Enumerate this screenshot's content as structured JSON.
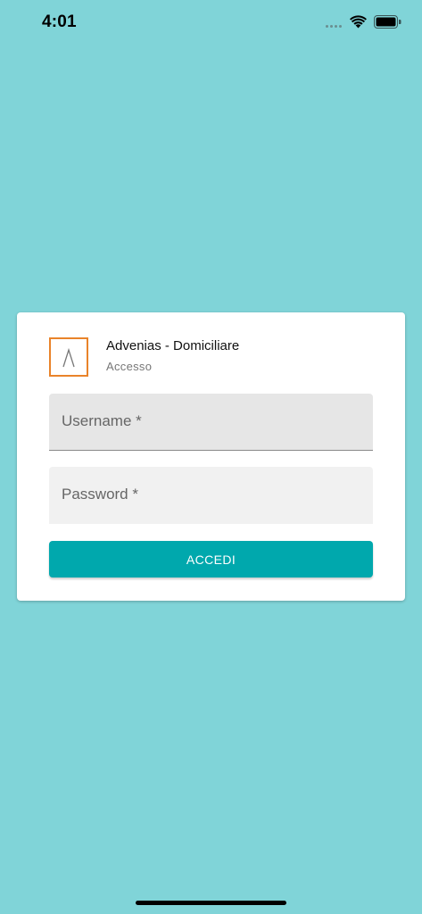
{
  "status_bar": {
    "time": "4:01"
  },
  "app": {
    "title": "Advenias - Domiciliare",
    "subtitle": "Accesso",
    "logo_color": "#e9832a"
  },
  "form": {
    "username_label": "Username *",
    "password_label": "Password *",
    "submit_label": "ACCEDI"
  },
  "colors": {
    "background": "#80d4d8",
    "accent": "#00a8ad"
  }
}
